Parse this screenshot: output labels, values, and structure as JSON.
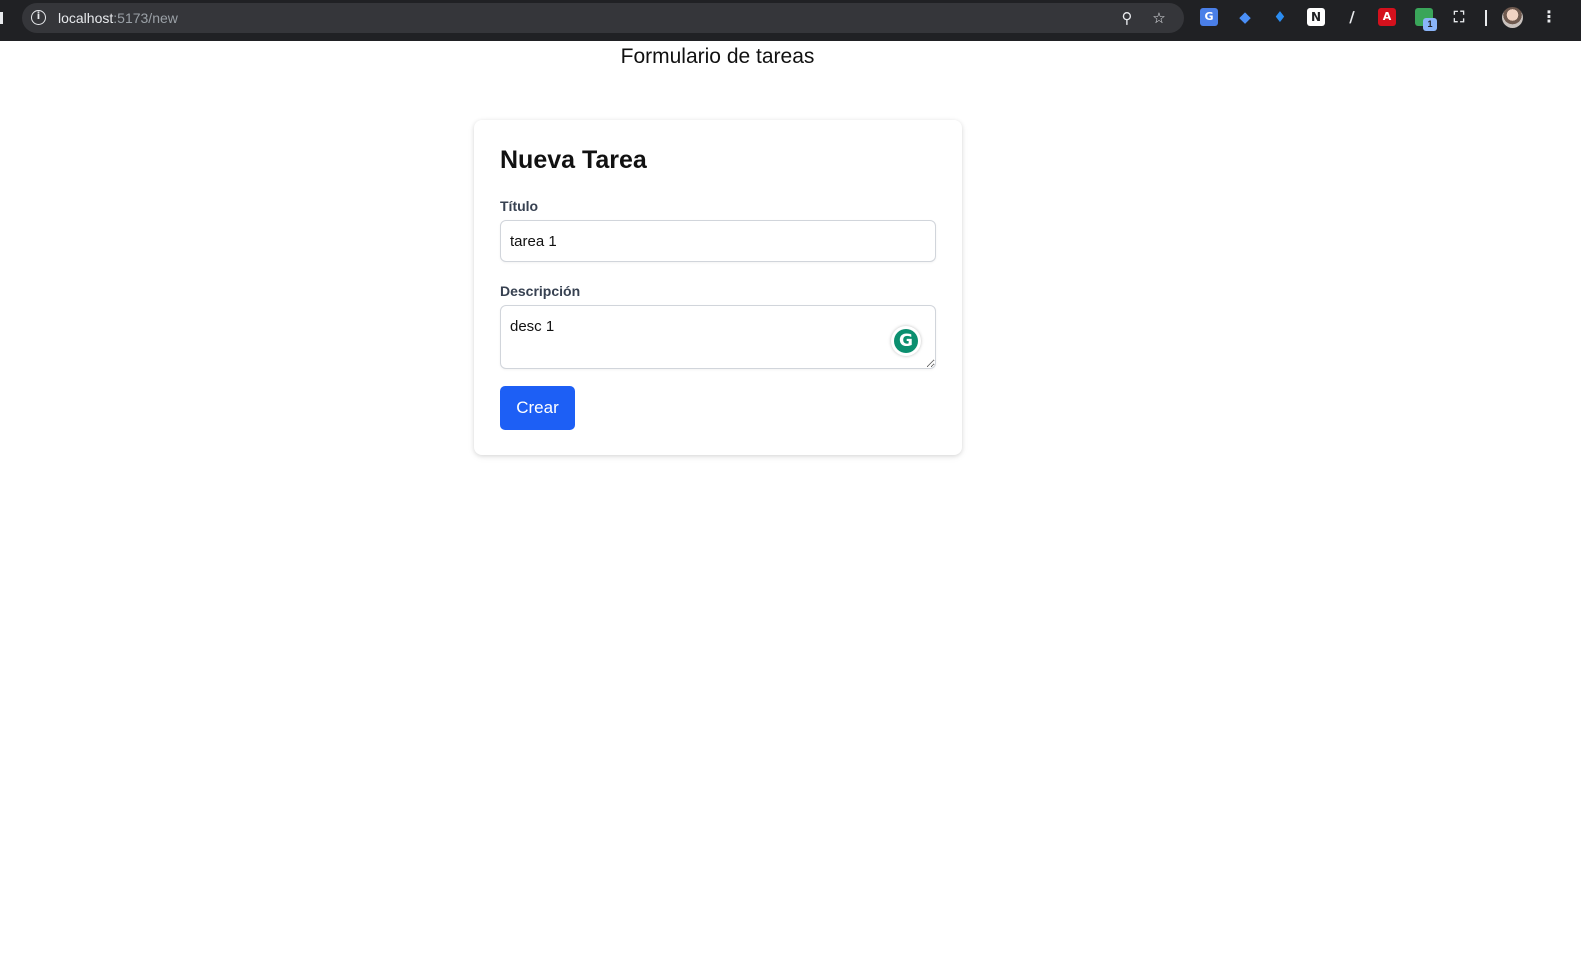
{
  "browser": {
    "url_host": "localhost",
    "url_path": ":5173/new",
    "extension_badge": "1"
  },
  "page": {
    "title": "Formulario de tareas"
  },
  "form": {
    "heading": "Nueva Tarea",
    "title_label": "Título",
    "title_value": "tarea 1",
    "description_label": "Descripción",
    "description_value": "desc 1",
    "submit_label": "Crear"
  },
  "colors": {
    "button": "#1d5ff5",
    "grammarly": "#0b8f6f"
  }
}
